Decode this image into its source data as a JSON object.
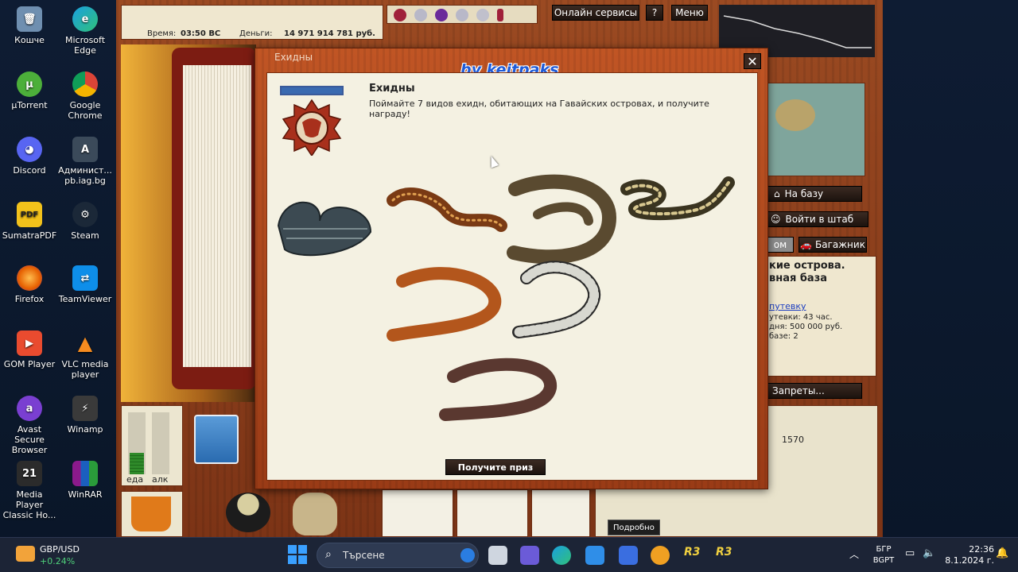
{
  "desktop": {
    "icons": [
      {
        "label": "Кошче"
      },
      {
        "label": "Microsoft Edge"
      },
      {
        "label": "µTorrent"
      },
      {
        "label": "Google Chrome"
      },
      {
        "label": "Discord"
      },
      {
        "label": "Админист... pb.iag.bg"
      },
      {
        "label": "SumatraPDF"
      },
      {
        "label": "Steam"
      },
      {
        "label": "Firefox"
      },
      {
        "label": "TeamViewer"
      },
      {
        "label": "GOM Player"
      },
      {
        "label": "VLC media player"
      },
      {
        "label": "Avast Secure Browser"
      },
      {
        "label": "Winamp"
      },
      {
        "label": "Media Player Classic Ho..."
      },
      {
        "label": "WinRAR"
      }
    ]
  },
  "game": {
    "time_label": "Время:",
    "time_value": "03:50 ВС",
    "money_label": "Деньги:",
    "money_value": "14 971 914 781 руб.",
    "online_services": "Онлайн сервисы",
    "help": "?",
    "menu": "Меню",
    "to_base": "На базу",
    "enter_hq": "Войти в штаб",
    "tab_partial": "ом",
    "trunk": "Багажник",
    "location_line1": "кие острова.",
    "location_line2": "вная база",
    "voucher_link": "путевку",
    "voucher_line1": "утевки: 43 час.",
    "voucher_line2": "дня: 500 000 руб.",
    "voucher_line3": "базе: 2",
    "bans": "Запреты...",
    "number": "1570",
    "food_label": "еда",
    "alcohol_label": "алк",
    "food_level": 0.35,
    "alcohol_level": 0.0,
    "details_tooltip": "Подробно"
  },
  "modal": {
    "window_title": "Ехидны",
    "watermark": "by keitpaks",
    "heading": "Ехидны",
    "description": "Поймайте 7 видов ехидн, обитающих на Гавайских островах, и получите награду!",
    "claim_button": "Получите приз"
  },
  "taskbar": {
    "widget_title": "GBP/USD",
    "widget_change": "+0.24%",
    "search_placeholder": "Търсене",
    "lang_line1": "БГР",
    "lang_line2": "BGPT",
    "time": "22:36",
    "date": "8.1.2024 г."
  },
  "colors": {
    "wood": "#9b4a22",
    "parchment": "#f4f1e2",
    "button_dark": "#1c130e",
    "watermark": "#1e5bd8"
  }
}
